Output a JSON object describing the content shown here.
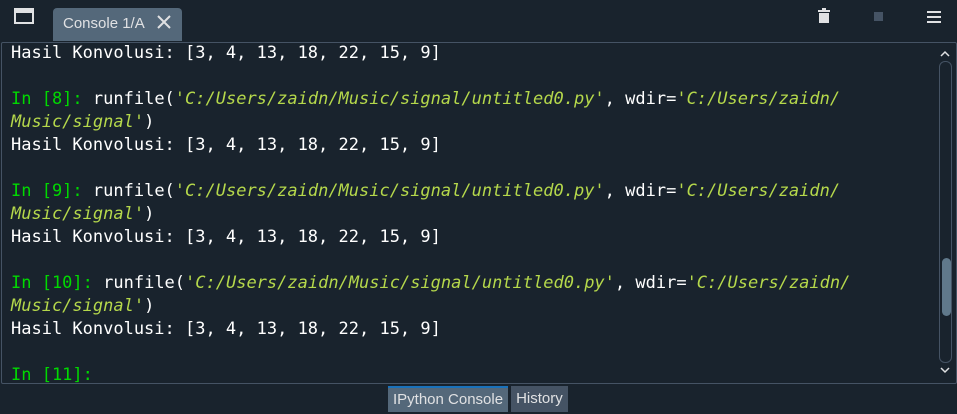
{
  "topbar": {
    "window_icon": "window-icon",
    "tab_label": "Console 1/A",
    "close_icon": "close-icon",
    "toolbar_icons": [
      "trash-icon",
      "stop-icon",
      "menu-icon"
    ]
  },
  "console": {
    "lines": [
      {
        "type": "output",
        "text": "Hasil Konvolusi: [3, 4, 13, 18, 22, 15, 9]"
      },
      {
        "type": "blank"
      },
      {
        "type": "input1",
        "prompt": "In [8]:",
        "cmd": "runfile(",
        "path": "'C:/Users/zaidn/Music/signal/untitled0.py'",
        "sep": ", wdir=",
        "wdir_part1": "'C:/Users/zaidn/"
      },
      {
        "type": "input2",
        "wdir_part2": "Music/signal'",
        "close": ")"
      },
      {
        "type": "output",
        "text": "Hasil Konvolusi: [3, 4, 13, 18, 22, 15, 9]"
      },
      {
        "type": "blank"
      },
      {
        "type": "input1",
        "prompt": "In [9]:",
        "cmd": "runfile(",
        "path": "'C:/Users/zaidn/Music/signal/untitled0.py'",
        "sep": ", wdir=",
        "wdir_part1": "'C:/Users/zaidn/"
      },
      {
        "type": "input2",
        "wdir_part2": "Music/signal'",
        "close": ")"
      },
      {
        "type": "output",
        "text": "Hasil Konvolusi: [3, 4, 13, 18, 22, 15, 9]"
      },
      {
        "type": "blank"
      },
      {
        "type": "input1",
        "prompt": "In [10]:",
        "cmd": "runfile(",
        "path": "'C:/Users/zaidn/Music/signal/untitled0.py'",
        "sep": ", wdir=",
        "wdir_part1": "'C:/Users/zaidn/"
      },
      {
        "type": "input2",
        "wdir_part2": "Music/signal'",
        "close": ")"
      },
      {
        "type": "output",
        "text": "Hasil Konvolusi: [3, 4, 13, 18, 22, 15, 9]"
      },
      {
        "type": "blank"
      },
      {
        "type": "prompt",
        "prompt": "In [11]:"
      }
    ],
    "scroll_position_fraction": 0.66
  },
  "bottom_tabs": [
    {
      "label": "IPython Console",
      "active": true
    },
    {
      "label": "History",
      "active": false
    }
  ],
  "colors": {
    "background": "#19232d",
    "prompt": "#00d900",
    "string": "#b5d84b",
    "text": "#ffffff",
    "tab_active": "#54687a"
  }
}
